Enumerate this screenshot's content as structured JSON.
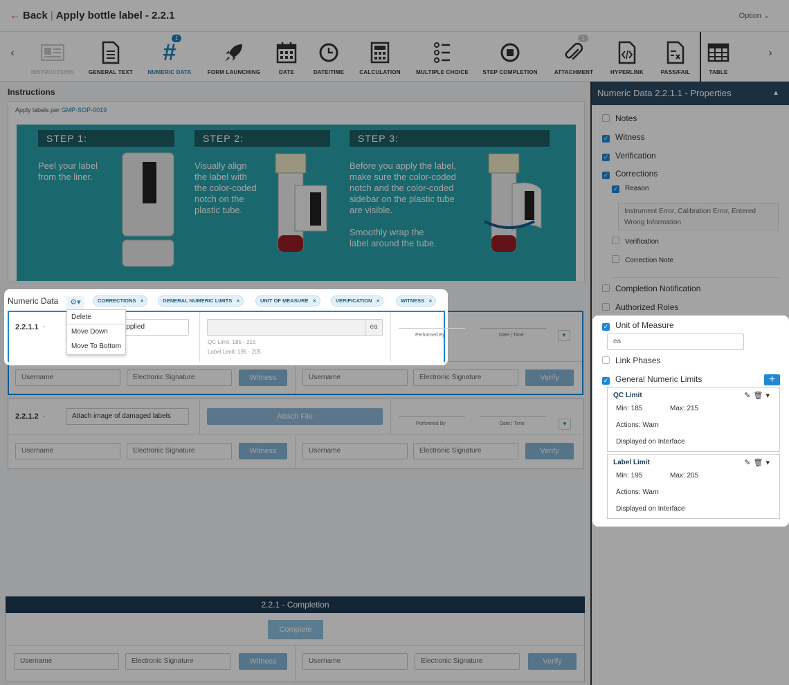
{
  "header": {
    "back_label": "Back",
    "title": "Apply bottle label - 2.2.1",
    "option_label": "Option"
  },
  "toolbar": {
    "prev": "‹",
    "next": "›",
    "items": [
      {
        "label": "INSTRUCTIONS",
        "icon": "instructions-icon"
      },
      {
        "label": "GENERAL TEXT",
        "icon": "document-icon"
      },
      {
        "label": "NUMERIC DATA",
        "icon": "hash-icon",
        "badge": "1"
      },
      {
        "label": "FORM LAUNCHING",
        "icon": "rocket-icon"
      },
      {
        "label": "DATE",
        "icon": "calendar-icon"
      },
      {
        "label": "DATE/TIME",
        "icon": "clock-icon"
      },
      {
        "label": "CALCULATION",
        "icon": "calculator-icon"
      },
      {
        "label": "MULTIPLE CHOICE",
        "icon": "list-icon"
      },
      {
        "label": "STEP COMPLETION",
        "icon": "stop-circle-icon"
      },
      {
        "label": "ATTACHMENT",
        "icon": "paperclip-icon",
        "badge": "1"
      },
      {
        "label": "HYPERLINK",
        "icon": "code-file-icon"
      },
      {
        "label": "PASS/FAIL",
        "icon": "checklist-file-icon"
      },
      {
        "label": "TABLE",
        "icon": "table-icon"
      }
    ]
  },
  "instructions": {
    "title": "Instructions",
    "text_prefix": "Apply labels per",
    "link": "GMP-SOP-0019",
    "steps": [
      {
        "heading": "STEP 1:",
        "text": "Peel your label\nfrom the liner."
      },
      {
        "heading": "STEP 2:",
        "text": "Visually align\nthe label with\nthe color-coded\nnotch on the\nplastic tube."
      },
      {
        "heading": "STEP 3:",
        "text": "Before you apply the label,\nmake sure the color-coded\nnotch and the color-coded\nsidebar on the plastic tube\nare visible.\n\nSmoothly wrap the\nlabel around the tube."
      }
    ]
  },
  "numeric": {
    "label": "Numeric Data",
    "tags": [
      "CORRECTIONS",
      "GENERAL NUMERIC LIMITS",
      "UNIT OF MEASURE",
      "VERIFICATION",
      "WITNESS"
    ],
    "menu": [
      "Delete",
      "Move Down",
      "Move To Bottom"
    ],
    "row1": {
      "id": "2.2.1.1",
      "input": "s applied",
      "unit": "ea",
      "qc_note": "QC Limit: 185 - 215",
      "label_note": "Label Limit: 195 - 205",
      "performed_by": "Performed By",
      "date_time": "Date | Time"
    },
    "row2": {
      "id": "2.2.1.2",
      "input": "Attach image of damaged labels",
      "attach": "Attach File",
      "performed_by": "Performed By",
      "date_time": "Date | Time"
    },
    "sign": {
      "username": "Username",
      "esig": "Electronic Signature",
      "witness": "Witness",
      "verify": "Verify"
    }
  },
  "completion": {
    "title": "2.2.1 - Completion",
    "button": "Complete"
  },
  "panel": {
    "title": "Numeric Data 2.2.1.1 - Properties",
    "notes": "Notes",
    "witness": "Witness",
    "verification": "Verification",
    "corrections": "Corrections",
    "reason": "Reason",
    "reason_text": "Instrument Error, Calibration Error, Entered Wrong Information",
    "sub_verification": "Verification",
    "correction_note": "Correction Note",
    "completion_notification": "Completion Notification",
    "authorized_roles": "Authorized Roles",
    "unit_of_measure": "Unit of Measure",
    "unit_value": "ea",
    "link_phases": "Link Phases",
    "general_limits": "General Numeric Limits",
    "qc": {
      "title": "QC Limit",
      "min": "Min:  185",
      "max": "Max:  215",
      "actions": "Actions:  Warn",
      "displayed": "Displayed on Interface"
    },
    "label": {
      "title": "Label Limit",
      "min": "Min:  195",
      "max": "Max:  205",
      "actions": "Actions:  Warn",
      "displayed": "Displayed on Interface"
    }
  }
}
